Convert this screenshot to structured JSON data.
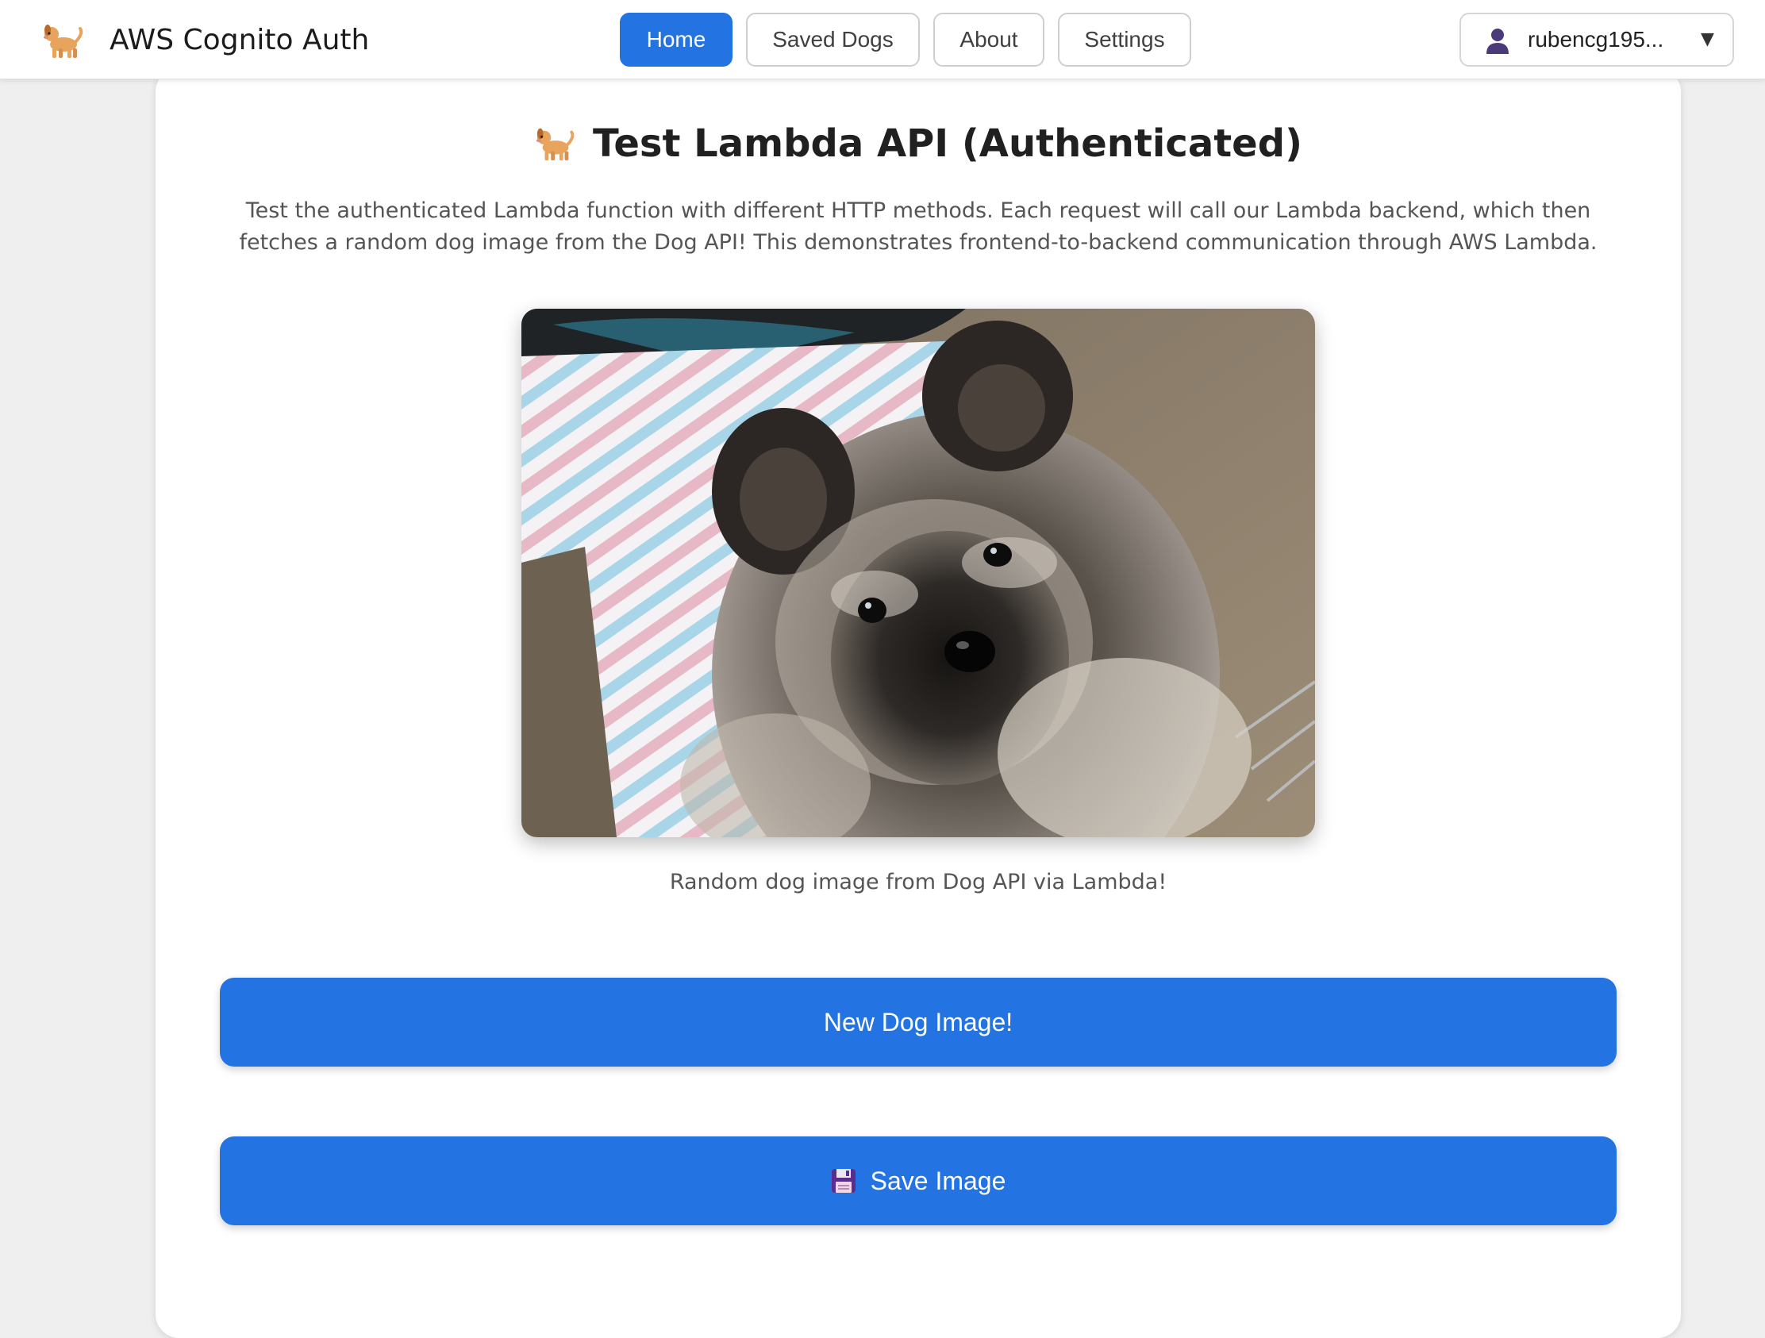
{
  "header": {
    "app_title": "AWS Cognito Auth",
    "brand_icon": "dog-icon",
    "nav": [
      {
        "label": "Home",
        "active": true
      },
      {
        "label": "Saved Dogs",
        "active": false
      },
      {
        "label": "About",
        "active": false
      },
      {
        "label": "Settings",
        "active": false
      }
    ],
    "user": {
      "name": "rubencg195...",
      "icon": "user-icon",
      "caret": "▼"
    }
  },
  "main": {
    "title": "Test Lambda API (Authenticated)",
    "title_icon": "dog-icon",
    "description": "Test the authenticated Lambda function with different HTTP methods. Each request will call our Lambda backend, which then fetches a random dog image from the Dog API! This demonstrates frontend-to-backend communication through AWS Lambda.",
    "image_caption": "Random dog image from Dog API via Lambda!",
    "new_image_label": "New Dog Image!",
    "save_label": "Save Image",
    "save_icon": "floppy-disk-icon"
  },
  "colors": {
    "primary": "#2473e2",
    "background": "#efefef",
    "card": "#ffffff"
  }
}
